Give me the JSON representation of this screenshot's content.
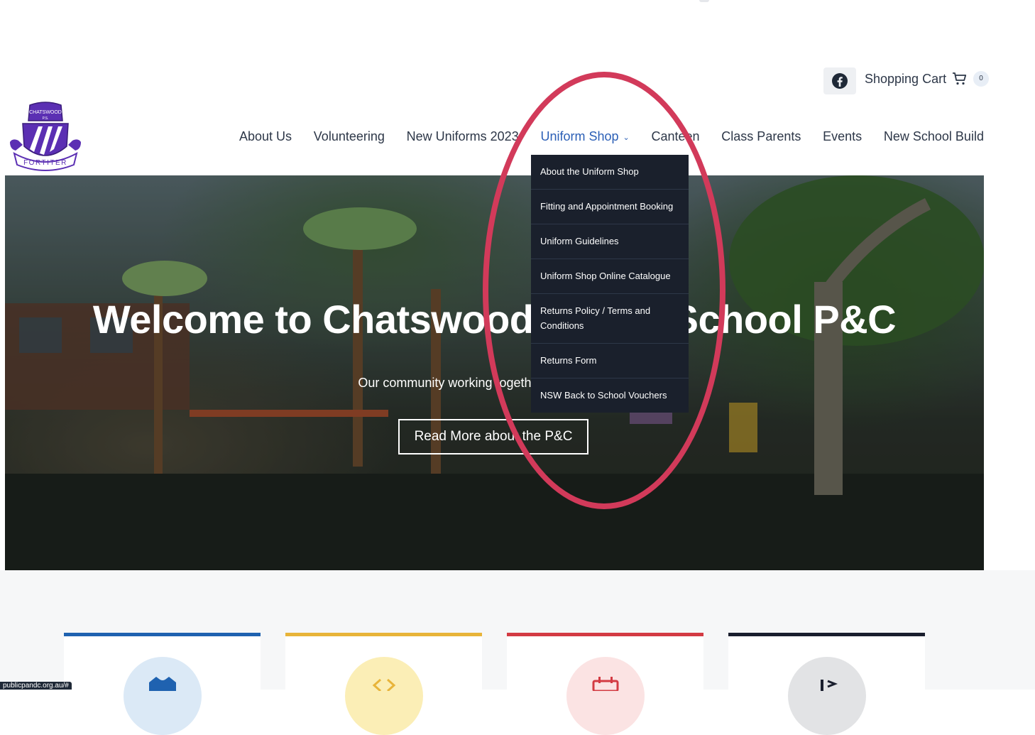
{
  "header": {
    "social": {
      "icon": "facebook-icon"
    },
    "cart": {
      "label": "Shopping Cart",
      "icon": "cart-icon",
      "count": "0"
    },
    "logo": {
      "top_text": "CHATSWOOD",
      "sub_text": "P.S.",
      "motto": "FORTITER",
      "colors": {
        "purple": "#5b2fb3",
        "gold": "#e8c020"
      }
    }
  },
  "nav": {
    "items": [
      "About Us",
      "Volunteering",
      "New Uniforms 2023",
      "Uniform Shop",
      "Canteen",
      "Class Parents",
      "Events",
      "New School Build"
    ],
    "active": "Uniform Shop",
    "accent": "#2b5fb6"
  },
  "dropdown": {
    "items": [
      "About the Uniform Shop",
      "Fitting and Appointment Booking",
      "Uniform Guidelines",
      "Uniform Shop Online Catalogue",
      "Returns Policy / Terms and Conditions",
      "Returns Form",
      "NSW Back to School Vouchers"
    ]
  },
  "hero": {
    "title": "Welcome to Chatswood Public School P&C",
    "subtitle": "Our community working together for the children",
    "button": "Read More about the P&C"
  },
  "cards": [
    {
      "color": "#1f62b0",
      "circle": "#dbe9f6",
      "icon": "shirt-icon"
    },
    {
      "color": "#e8b43a",
      "circle": "#fbeeb6",
      "icon": "code-icon"
    },
    {
      "color": "#d33b43",
      "circle": "#fbe3e3",
      "icon": "calendar-icon"
    },
    {
      "color": "#1a1f2e",
      "circle": "#e2e3e5",
      "icon": "build-icon"
    }
  ],
  "annotation": {
    "color": "#d23a5a"
  },
  "status_bar": {
    "url": "publicpandc.org.au/#"
  }
}
